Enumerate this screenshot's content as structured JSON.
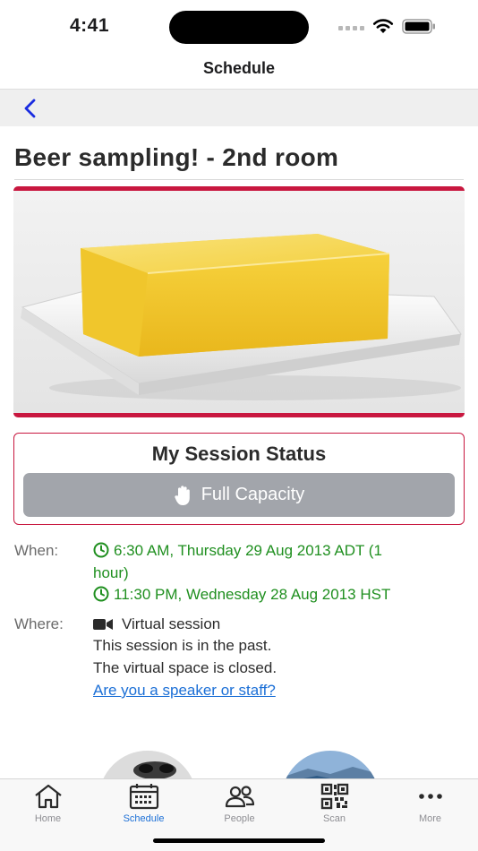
{
  "status_bar": {
    "time": "4:41"
  },
  "nav": {
    "title": "Schedule",
    "back_icon": "chevron-left-icon"
  },
  "session": {
    "title": "Beer sampling! - 2nd room",
    "image_icon": "cheese-photo",
    "status_card": {
      "title": "My Session Status",
      "button_label": "Full Capacity",
      "button_icon": "raised-hand-icon"
    },
    "when": {
      "label": "When:",
      "time_1_line_1": "6:30 AM, Thursday 29 Aug 2013 ADT (1",
      "time_1_line_2": "hour)",
      "time_2": "11:30 PM, Wednesday 28 Aug 2013 HST"
    },
    "where": {
      "label": "Where:",
      "location": "Virtual session",
      "note_1": "This session is in the past.",
      "note_2": "The virtual space is closed.",
      "link": "Are you a speaker or staff?"
    }
  },
  "tabs": [
    {
      "label": "Home",
      "icon": "home-icon"
    },
    {
      "label": "Schedule",
      "icon": "calendar-icon",
      "active": true
    },
    {
      "label": "People",
      "icon": "people-icon"
    },
    {
      "label": "Scan",
      "icon": "qr-code-icon"
    },
    {
      "label": "More",
      "icon": "more-icon"
    }
  ],
  "colors": {
    "accent": "#c8173f",
    "link": "#1b6fd6",
    "time_green": "#1f8f1f",
    "button_gray": "#a2a5ab"
  }
}
